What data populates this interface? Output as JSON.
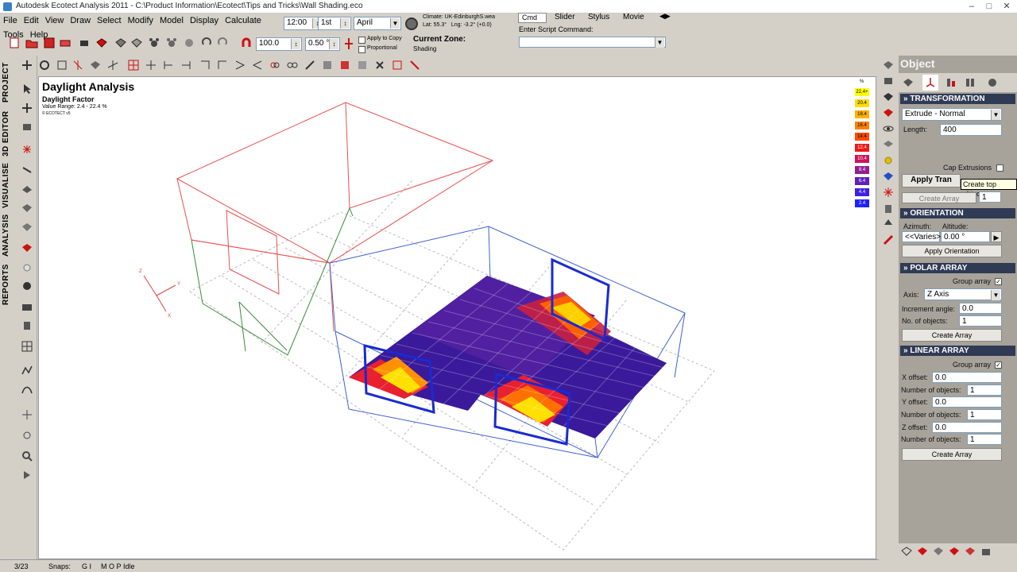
{
  "window": {
    "title": "Autodesk Ecotect Analysis 2011 - C:\\Product Information\\Ecotect\\Tips and Tricks\\Wall Shading.eco"
  },
  "menu": [
    "File",
    "Edit",
    "View",
    "Draw",
    "Select",
    "Modify",
    "Model",
    "Display",
    "Calculate",
    "Tools",
    "Help"
  ],
  "time": {
    "time": "12:00",
    "day": "1st",
    "month": "April"
  },
  "climate": {
    "label": "Climate:",
    "file": "UK-EdinburghS.wea",
    "lat": "Lat: 55.3°",
    "lng": "Lng: -3.2° (+0.0)"
  },
  "script": {
    "tabs": [
      "Cmd",
      "Slider",
      "Stylus",
      "Movie"
    ],
    "label": "Enter Script Command:"
  },
  "transform_fields": {
    "scale": "100.0",
    "angle": "0.50 °",
    "apply_copy": "Apply to Copy",
    "proportional": "Proportional"
  },
  "zone": {
    "label": "Current Zone:",
    "value": "Shading"
  },
  "side_tabs": [
    "PROJECT",
    "3D EDITOR",
    "VISUALISE",
    "ANALYSIS",
    "REPORTS"
  ],
  "viewport": {
    "title": "Daylight Analysis",
    "subtitle": "Daylight Factor",
    "range": "Value Range: 2.4 - 22.4 %",
    "brand": "© ECOTECT v5",
    "axes": {
      "x": "X",
      "y": "Y",
      "z": "Z"
    }
  },
  "legend": {
    "unit": "%",
    "values": [
      "22.4+",
      "20.4",
      "18.4",
      "16.4",
      "14.4",
      "12.4",
      "10.4",
      "8.4",
      "6.4",
      "4.4",
      "2.4"
    ],
    "colors": [
      "#ffff00",
      "#ffdd00",
      "#ffb000",
      "#ff8000",
      "#ff4a00",
      "#f01818",
      "#d0105a",
      "#902090",
      "#6020b8",
      "#4020e0",
      "#2020ff"
    ]
  },
  "panel": {
    "title": "Object Transformation",
    "transformation": {
      "header": "TRANSFORMATION",
      "mode": "Extrude - Normal",
      "length_label": "Length:",
      "length": "400",
      "cap_label": "Cap Extrusions",
      "tooltip": "Create top object",
      "apply_btn": "Apply Tran",
      "create_array_btn": "Create Array",
      "array_count": "1"
    },
    "orientation": {
      "header": "ORIENTATION",
      "azimuth_label": "Azimuth:",
      "altitude_label": "Altitude:",
      "azimuth": "<<Varies>>",
      "altitude": "0.00 °",
      "apply_btn": "Apply Orientation"
    },
    "polar": {
      "header": "POLAR ARRAY",
      "group_label": "Group array",
      "axis_label": "Axis:",
      "axis": "Z Axis",
      "increment_label": "Increment angle:",
      "increment": "0.0",
      "num_label": "No. of objects:",
      "num": "1",
      "create_btn": "Create Array"
    },
    "linear": {
      "header": "LINEAR ARRAY",
      "group_label": "Group array",
      "x_label": "X offset:",
      "x": "0.0",
      "nx_label": "Number of objects:",
      "nx": "1",
      "y_label": "Y offset:",
      "y": "0.0",
      "ny_label": "Number of objects:",
      "ny": "1",
      "z_label": "Z offset:",
      "z": "0.0",
      "nz_label": "Number of objects:",
      "nz": "1",
      "create_btn": "Create Array"
    }
  },
  "status": {
    "page": "3/23",
    "snaps": "Snaps:",
    "gi": "G I",
    "mop": "M O P",
    "state": "Idle"
  }
}
